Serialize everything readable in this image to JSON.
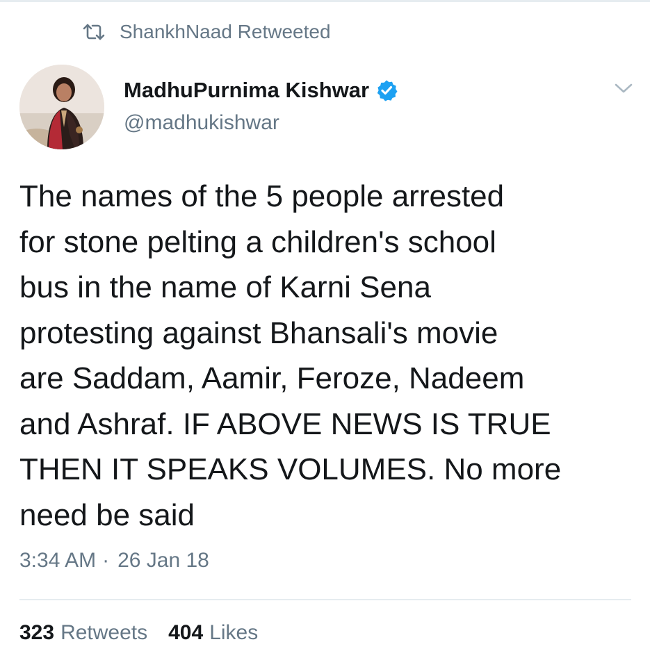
{
  "retweet_context": {
    "icon": "retweet-icon",
    "text": "ShankhNaad Retweeted"
  },
  "author": {
    "display_name": "MadhuPurnima Kishwar",
    "handle": "@madhukishwar",
    "verified_icon": "verified-badge-icon"
  },
  "menu_icon": "chevron-down-icon",
  "tweet": {
    "lines": [
      "The names of the 5 people arrested",
      "for stone pelting a children's school",
      "bus in the name of Karni Sena",
      "protesting against Bhansali's movie",
      "are Saddam, Aamir, Feroze, Nadeem",
      "and Ashraf. IF ABOVE NEWS IS TRUE",
      "THEN IT SPEAKS VOLUMES. No more",
      "need be said"
    ],
    "time": "3:34 AM",
    "separator": "·",
    "date": "26 Jan 18"
  },
  "stats": {
    "retweets_count": "323",
    "retweets_label": "Retweets",
    "likes_count": "404",
    "likes_label": "Likes"
  },
  "colors": {
    "text_primary": "#14171a",
    "text_secondary": "#657786",
    "verified_blue": "#1da1f2",
    "divider": "#e6ecf0"
  }
}
